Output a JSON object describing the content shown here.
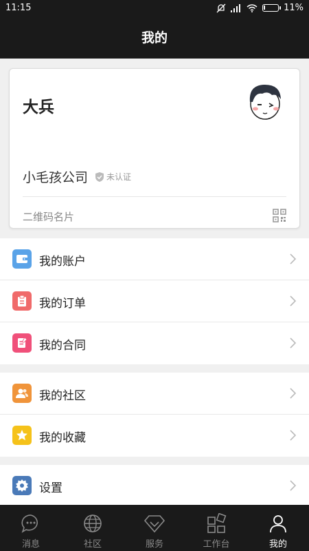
{
  "status_bar": {
    "time": "11:15",
    "battery_text": "11%",
    "battery_level": 0.11
  },
  "header": {
    "title": "我的"
  },
  "profile": {
    "name": "大兵",
    "company": "小毛孩公司",
    "verify_status": "未认证",
    "qr_label": "二维码名片"
  },
  "menu_groups": [
    {
      "items": [
        {
          "label": "我的账户",
          "icon": "wallet-icon",
          "color": "#5aa3e8"
        },
        {
          "label": "我的订单",
          "icon": "order-clipboard-icon",
          "color": "#f06a6a"
        },
        {
          "label": "我的合同",
          "icon": "contract-edit-icon",
          "color": "#f0507a"
        }
      ]
    },
    {
      "items": [
        {
          "label": "我的社区",
          "icon": "community-people-icon",
          "color": "#f0943a"
        },
        {
          "label": "我的收藏",
          "icon": "favorite-star-icon",
          "color": "#f5c21a"
        }
      ]
    },
    {
      "items": [
        {
          "label": "设置",
          "icon": "settings-gear-icon",
          "color": "#4a7ab8"
        }
      ]
    }
  ],
  "tabs": [
    {
      "label": "消息",
      "icon": "message-bubble-icon",
      "active": false
    },
    {
      "label": "社区",
      "icon": "globe-icon",
      "active": false
    },
    {
      "label": "服务",
      "icon": "diamond-icon",
      "active": false
    },
    {
      "label": "工作台",
      "icon": "workbench-grid-icon",
      "active": false
    },
    {
      "label": "我的",
      "icon": "person-icon",
      "active": true
    }
  ]
}
